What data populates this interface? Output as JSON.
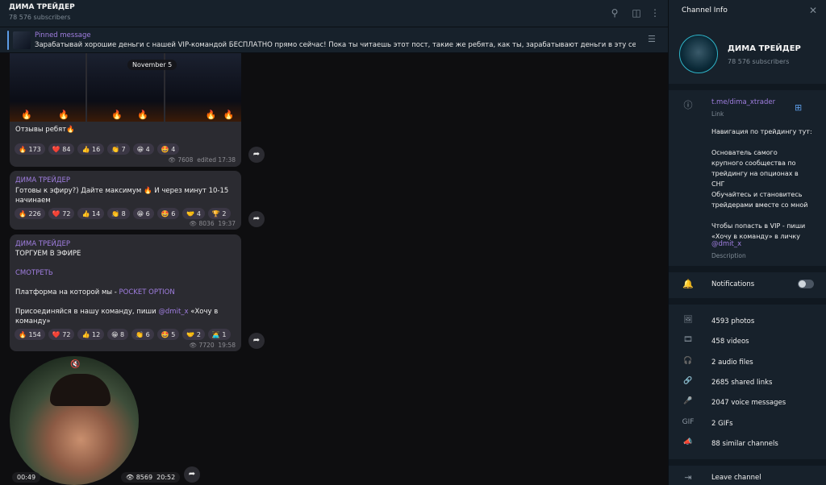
{
  "header": {
    "title": "ДИМА ТРЕЙДЕР",
    "subtitle": "78 576 subscribers"
  },
  "pinned": {
    "title": "Pinned message",
    "text": "Зарабатывай хорошие деньги с нашей VIP-командой БЕСПЛАТНО прямо сейчас! Пока ты читаешь этот пост, такие же ребята, как ты, зарабатывают деньги в эту секунду в V..."
  },
  "date_chip": "November 5",
  "messages": [
    {
      "text": "Отзывы ребят🔥",
      "reactions": [
        "🔥 173",
        "❤️ 84",
        "👍 16",
        "👏 7",
        "😁 4",
        "🤩 4"
      ],
      "views": "7608",
      "time": "edited 17:38"
    },
    {
      "author": "ДИМА ТРЕЙДЕР",
      "text1": "Готовы к эфиру?) Дайте максимум 🔥 И через минут 10-15",
      "text2": "начинаем",
      "reactions": [
        "🔥 226",
        "❤️ 72",
        "👍 14",
        "👏 8",
        "😁 6",
        "🤩 6",
        "🤝 4",
        "🏆 2"
      ],
      "views": "8036",
      "time": "19:37"
    },
    {
      "author": "ДИМА ТРЕЙДЕР",
      "line1": "ТОРГУЕМ В ЭФИРЕ",
      "watch": "СМОТРЕТЬ",
      "platform_prefix": "Платформа на которой мы - ",
      "platform_link": "POCKET OPTION",
      "join_prefix": "Присоединяйся в нашу команду, пиши ",
      "join_link": "@dmit_x",
      "join_suffix": " «Хочу в",
      "join_line2": "команду»",
      "reactions": [
        "🔥 154",
        "❤️ 72",
        "👍 12",
        "😁 8",
        "👏 6",
        "🤩 5",
        "🤝 2",
        "🧑‍💻 1"
      ],
      "views": "7720",
      "time": "19:58"
    }
  ],
  "video": {
    "duration": "00:49",
    "views": "8569",
    "time": "20:52"
  },
  "panel": {
    "title": "Channel Info",
    "name": "ДИМА ТРЕЙДЕР",
    "subs": "78 576 subscribers",
    "link": "t.me/dima_xtrader",
    "link_label": "Link",
    "description_lines": [
      "Навигация по трейдингу тут:",
      "",
      "Основатель самого",
      "крупного сообщества по",
      "трейдингу на опционах в",
      "СНГ",
      "Обучайтесь и становитесь",
      "трейдерами вместе со мной",
      "",
      "Чтобы попасть в VIP - пиши",
      "«Хочу в команду» в личку"
    ],
    "description_handle": "@dmit_x",
    "description_label": "Description",
    "notifications": "Notifications",
    "media": [
      "4593 photos",
      "458 videos",
      "2 audio files",
      "2685 shared links",
      "2047 voice messages",
      "2 GIFs",
      "88 similar channels"
    ],
    "leave": "Leave channel"
  }
}
